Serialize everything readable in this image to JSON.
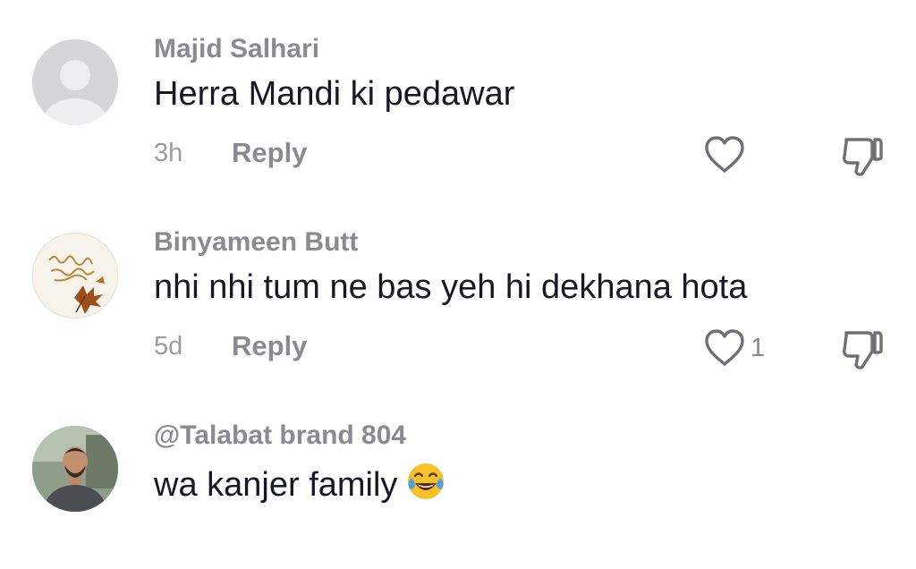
{
  "comments": [
    {
      "username": "Majid Salhari",
      "text": "Herra Mandi ki pedawar",
      "time": "3h",
      "reply_label": "Reply",
      "like_count": "",
      "avatar_icon": "default-avatar-icon"
    },
    {
      "username": "Binyameen Butt",
      "text": "nhi nhi tum ne bas yeh hi dekhana hota",
      "time": "5d",
      "reply_label": "Reply",
      "like_count": "1",
      "avatar_icon": "calligraphy-leaf-avatar"
    },
    {
      "username": "@Talabat brand 804",
      "text": "wa kanjer family",
      "emoji_icon": "face-with-tears-of-joy-icon",
      "avatar_icon": "photo-avatar"
    }
  ],
  "colors": {
    "username": "#8a8b91",
    "text": "#161823",
    "meta": "#9b9ca1",
    "icon": "#6f7076",
    "background": "#ffffff"
  }
}
